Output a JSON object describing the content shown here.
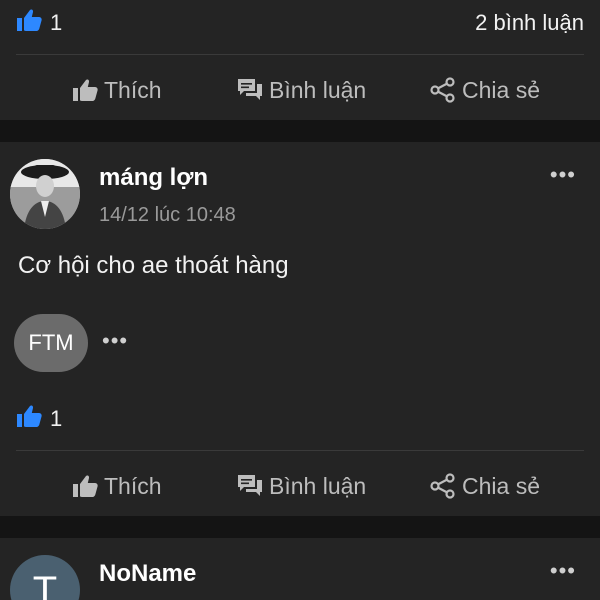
{
  "top_card": {
    "like_count": "1",
    "comment_count": "2 bình luận"
  },
  "actions": {
    "like_label": "Thích",
    "comment_label": "Bình luận",
    "share_label": "Chia sẻ"
  },
  "post": {
    "author": "máng lợn",
    "timestamp": "14/12 lúc 10:48",
    "text": "Cơ hội cho ae thoát hàng",
    "tag": "FTM",
    "more": "•••",
    "tag_more": "•••",
    "like_count": "1"
  },
  "next_post": {
    "author": "NoName",
    "avatar_letter": "T",
    "more": "•••"
  },
  "colors": {
    "background": "#141414",
    "card": "#242424",
    "like_blue": "#2d88ff",
    "action_grey": "#bdbdbd"
  },
  "icons": [
    "thumbs-up-icon",
    "comment-icon",
    "share-icon",
    "more-icon"
  ]
}
